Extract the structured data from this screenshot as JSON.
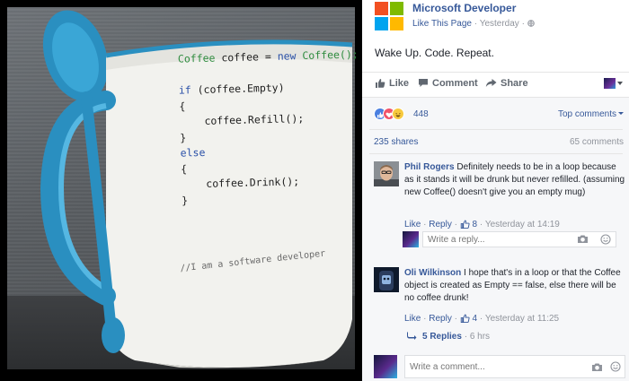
{
  "photo": {
    "code_lines": [
      [
        {
          "t": "Coffee ",
          "c": "green"
        },
        {
          "t": "coffee",
          "c": "dark"
        },
        {
          "t": " = ",
          "c": "dark"
        },
        {
          "t": "new ",
          "c": "blue"
        },
        {
          "t": "Coffee();",
          "c": "green"
        }
      ],
      [],
      [
        {
          "t": "if ",
          "c": "blue"
        },
        {
          "t": "(coffee.Empty)",
          "c": "dark"
        }
      ],
      [
        {
          "t": "{",
          "c": "dark"
        }
      ],
      [
        {
          "t": "    coffee.Refill();",
          "c": "dark"
        }
      ],
      [
        {
          "t": "}",
          "c": "dark"
        }
      ],
      [
        {
          "t": "else",
          "c": "blue"
        }
      ],
      [
        {
          "t": "{",
          "c": "dark"
        }
      ],
      [
        {
          "t": "    coffee.Drink();",
          "c": "dark"
        }
      ],
      [
        {
          "t": "}",
          "c": "dark"
        }
      ]
    ],
    "comment_line": "//I am a software developer",
    "colors": {
      "green": "#2e8b3e",
      "blue": "#2b51a8",
      "dark": "#1e1e1e",
      "mug_accent": "#2a8fc0"
    }
  },
  "post": {
    "page_name": "Microsoft Developer",
    "like_page": "Like This Page",
    "timestamp": "Yesterday",
    "separator": "·",
    "privacy_icon": "globe-icon",
    "text": "Wake Up. Code. Repeat.",
    "logo_colors": [
      "#f25022",
      "#7fba00",
      "#00a4ef",
      "#ffb900"
    ]
  },
  "actions": {
    "like": "Like",
    "comment": "Comment",
    "share": "Share"
  },
  "stats": {
    "reaction_count": "448",
    "reaction_icons": [
      "like-reaction-icon",
      "love-reaction-icon",
      "haha-reaction-icon"
    ],
    "sort_label": "Top comments",
    "shares": "235 shares",
    "comments": "65 comments"
  },
  "comments": [
    {
      "author": "Phil Rogers",
      "text": "Definitely needs to be in a loop because as it stands it will be drunk but never refilled. (assuming new Coffee() doesn't give you an empty mug)",
      "like": "Like",
      "reply": "Reply",
      "likes": "8",
      "time": "Yesterday at 14:19"
    },
    {
      "author": "Oli Wilkinson",
      "text": "I hope that's in a loop or that the Coffee object is created as Empty == false, else there will be no coffee drunk!",
      "like": "Like",
      "reply": "Reply",
      "likes": "4",
      "time": "Yesterday at 11:25"
    }
  ],
  "reply_box": {
    "placeholder": "Write a reply..."
  },
  "replies": {
    "label": "5 Replies",
    "time": "6 hrs"
  },
  "comment_box": {
    "placeholder": "Write a comment..."
  },
  "sep": "·"
}
